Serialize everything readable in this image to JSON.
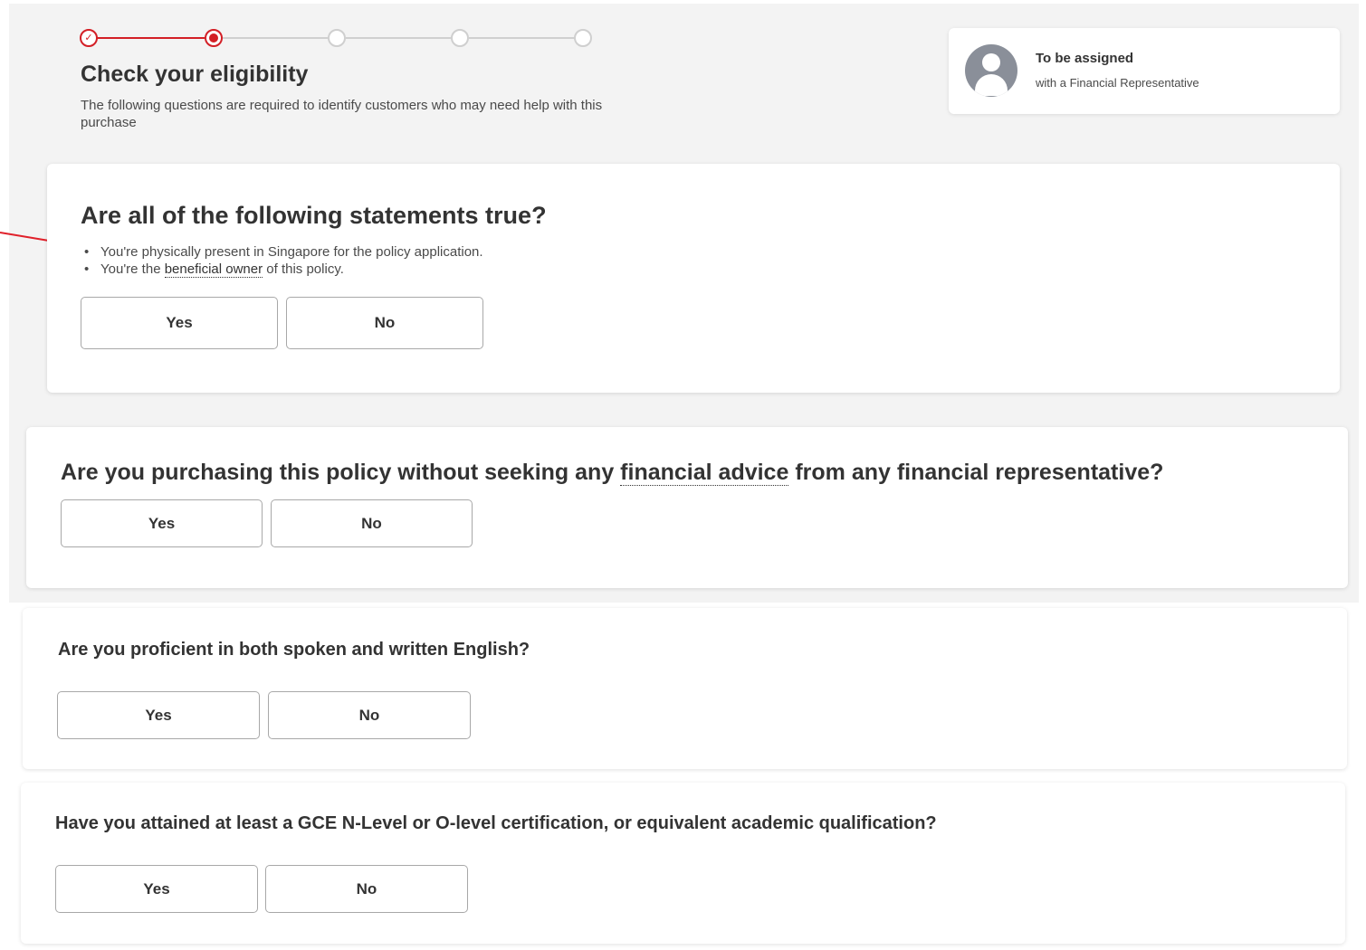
{
  "header": {
    "title": "Check your eligibility",
    "subtitle": "The following questions are required to identify customers who may need help with this purchase"
  },
  "stepper": {
    "total_steps": 5,
    "completed_steps": 1,
    "active_step": 2,
    "accent_color": "#d31f26"
  },
  "agent": {
    "name": "To be assigned",
    "subtitle": "with a Financial Representative",
    "icon": "user-avatar-icon"
  },
  "questions": [
    {
      "title": "Are all of the following statements true?",
      "statements": [
        {
          "before": "You're physically present in Singapore for the policy application.",
          "term": "",
          "after": ""
        },
        {
          "before": "You're the ",
          "term": "beneficial owner",
          "after": " of this policy."
        }
      ],
      "yes_label": "Yes",
      "no_label": "No"
    },
    {
      "title_before": "Are you purchasing this policy without seeking any ",
      "title_term": "financial advice",
      "title_after": " from any financial representative?",
      "yes_label": "Yes",
      "no_label": "No"
    },
    {
      "title": "Are you proficient in both spoken and written English?",
      "yes_label": "Yes",
      "no_label": "No"
    },
    {
      "title": "Have you attained at least a GCE N-Level or O-level certification, or equivalent academic qualification?",
      "yes_label": "Yes",
      "no_label": "No"
    }
  ],
  "annotation": {
    "arrow_color": "#e0202a"
  }
}
